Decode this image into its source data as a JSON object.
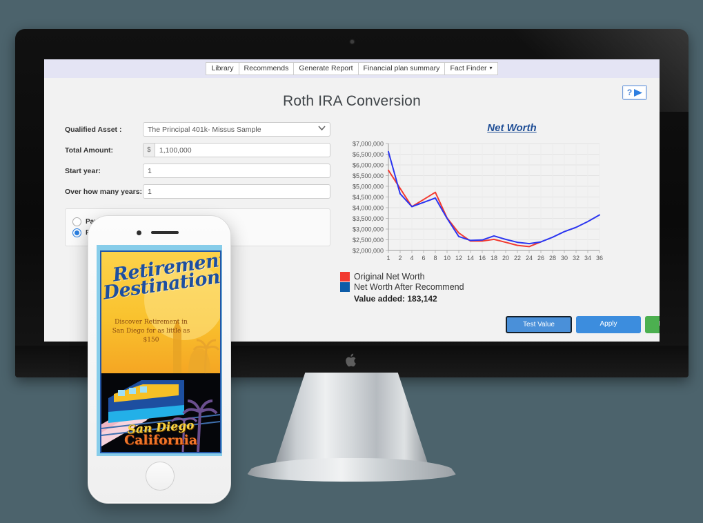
{
  "nav": {
    "tabs": [
      {
        "label": "Library"
      },
      {
        "label": "Recommends"
      },
      {
        "label": "Generate Report"
      },
      {
        "label": "Financial plan summary"
      },
      {
        "label": "Fact Finder",
        "caret": "▾"
      }
    ]
  },
  "help": {
    "question_mark": "?",
    "icon": "play-icon"
  },
  "page": {
    "title": "Roth IRA Conversion"
  },
  "form": {
    "qualified_asset": {
      "label": "Qualified Asset :",
      "value": "The Principal 401k- Missus Sample",
      "options": [
        "The Principal 401k- Missus Sample"
      ]
    },
    "total_amount": {
      "label": "Total Amount:",
      "prefix": "$",
      "value": "1,100,000"
    },
    "start_year": {
      "label": "Start year:",
      "value": "1"
    },
    "over_years": {
      "label": "Over how many years:",
      "value": "1"
    },
    "pay_options": [
      {
        "label": "Pay t",
        "selected": false
      },
      {
        "label": "Pay f",
        "selected": true
      }
    ]
  },
  "legend": {
    "original": {
      "label": "Original Net Worth",
      "color": "#f23a30"
    },
    "recommend": {
      "label": "Net Worth After Recommend",
      "color": "#0d5ca8"
    },
    "value_added": "Value added: 183,142"
  },
  "buttons": {
    "test": "Test Value",
    "apply": "Apply",
    "back": "Back to plan"
  },
  "phone": {
    "poster": {
      "title_line1": "Retirement",
      "title_line2": "Destinations",
      "subtitle": "Discover Retirement in San Diego for as little as $150",
      "footer_line1": "San Diego",
      "footer_line2": "California"
    }
  },
  "chart_data": {
    "type": "line",
    "title": "Net Worth",
    "xlabel": "",
    "ylabel": "",
    "ylim": [
      2000000,
      7000000
    ],
    "ytick_labels": [
      "$7,000,000",
      "$6,500,000",
      "$6,000,000",
      "$5,500,000",
      "$5,000,000",
      "$4,500,000",
      "$4,000,000",
      "$3,500,000",
      "$3,000,000",
      "$2,500,000",
      "$2,000,000"
    ],
    "ytick_values": [
      7000000,
      6500000,
      6000000,
      5500000,
      5000000,
      4500000,
      4000000,
      3500000,
      3000000,
      2500000,
      2000000
    ],
    "xtick_labels": [
      "1",
      "2",
      "4",
      "6",
      "8",
      "10",
      "12",
      "14",
      "16",
      "18",
      "20",
      "22",
      "24",
      "26",
      "28",
      "30",
      "32",
      "34",
      "36"
    ],
    "x": [
      1,
      2,
      4,
      6,
      8,
      10,
      12,
      14,
      16,
      18,
      20,
      22,
      24,
      26,
      28,
      30,
      32,
      34,
      36
    ],
    "grid": true,
    "legend_position": "below",
    "series": [
      {
        "name": "Original Net Worth",
        "color": "#f23a30",
        "x": [
          1,
          2,
          4,
          6,
          8,
          10,
          12,
          14,
          16,
          18,
          20,
          22,
          24,
          26
        ],
        "values": [
          5750000,
          4900000,
          4050000,
          4380000,
          4720000,
          3520000,
          2820000,
          2440000,
          2440000,
          2520000,
          2380000,
          2240000,
          2180000,
          2400000
        ]
      },
      {
        "name": "Net Worth After Recommend",
        "color": "#2b35f0",
        "x": [
          1,
          2,
          4,
          6,
          8,
          10,
          12,
          14,
          16,
          18,
          20,
          22,
          24,
          26,
          28,
          30,
          32,
          34,
          36
        ],
        "values": [
          6620000,
          4650000,
          4050000,
          4250000,
          4450000,
          3500000,
          2650000,
          2470000,
          2490000,
          2680000,
          2520000,
          2380000,
          2320000,
          2400000,
          2620000,
          2880000,
          3080000,
          3350000,
          3660000
        ]
      }
    ]
  }
}
